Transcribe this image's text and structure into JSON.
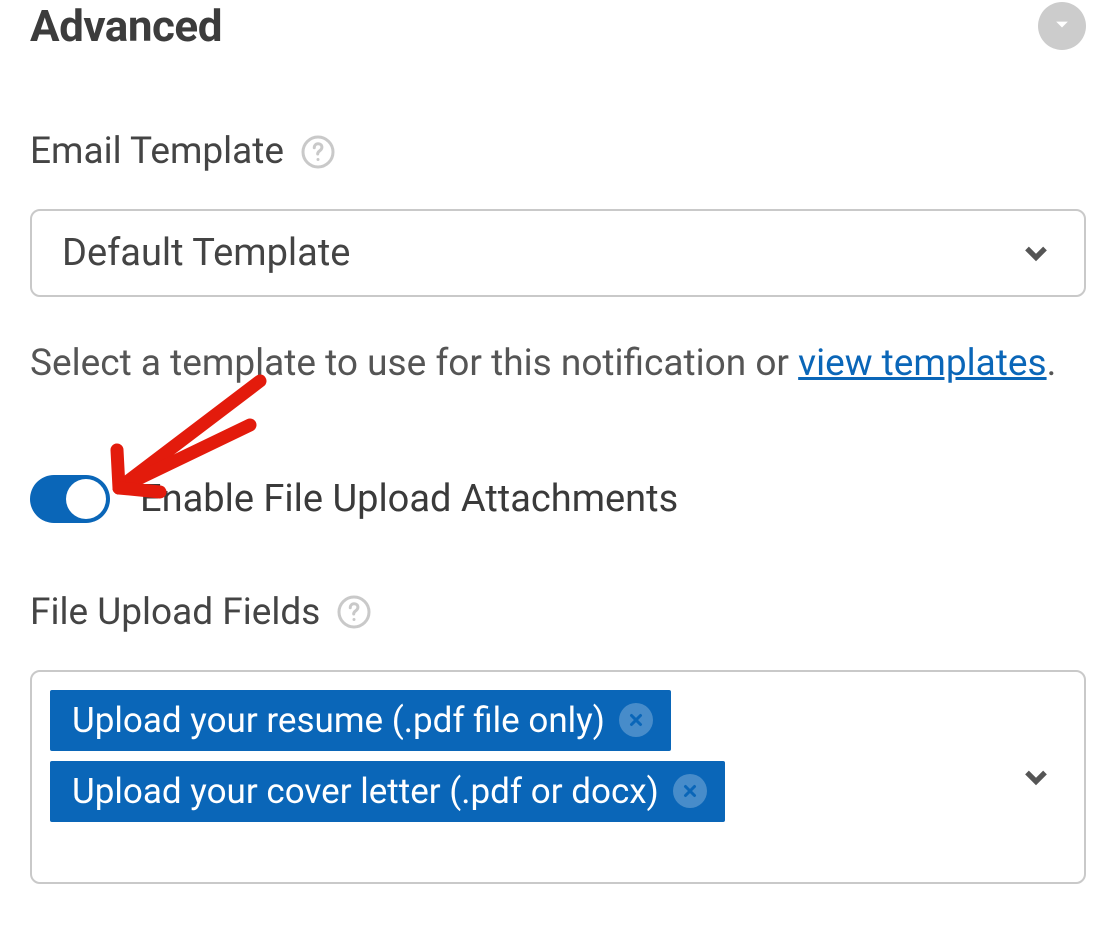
{
  "header": {
    "title": "Advanced"
  },
  "email_template": {
    "label": "Email Template",
    "selected": "Default Template",
    "helper_prefix": "Select a template to use for this notification or ",
    "link_text": "view templates",
    "helper_suffix": "."
  },
  "attachments_toggle": {
    "label": "Enable File Upload Attachments",
    "enabled": true
  },
  "file_upload_fields": {
    "label": "File Upload Fields",
    "selected": [
      "Upload your resume (.pdf file only)",
      "Upload your cover letter (.pdf or docx)"
    ]
  }
}
